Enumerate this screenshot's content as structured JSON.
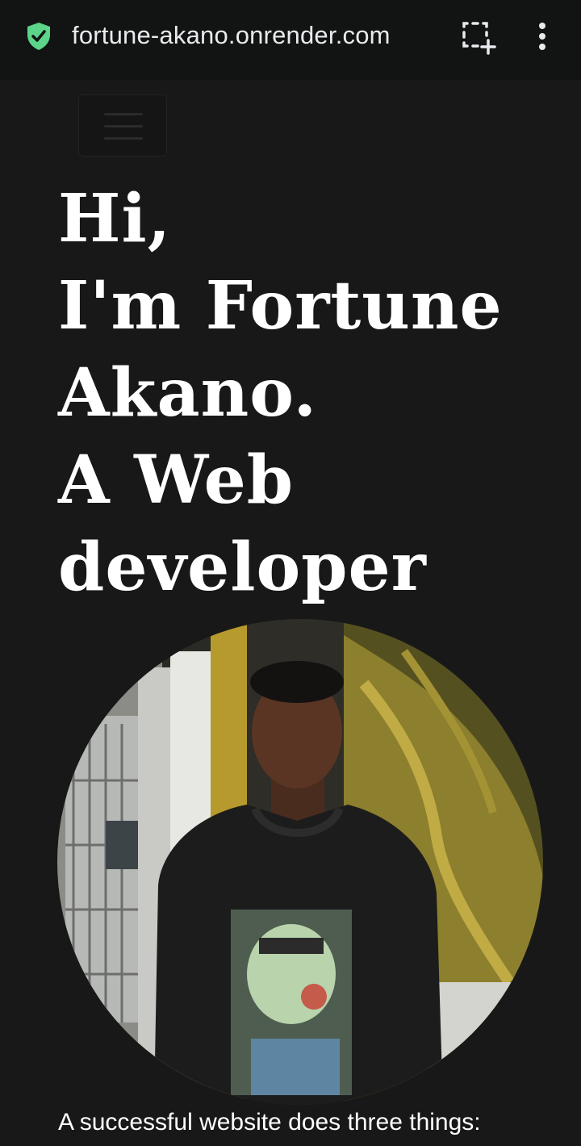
{
  "browser": {
    "url": "fortune-akano.onrender.com",
    "icons": [
      "shield-check-icon",
      "screenshot-select-icon",
      "more-vertical-icon"
    ],
    "accent_color": "#5cd48a"
  },
  "nav": {
    "menu_icon": "hamburger-menu-icon"
  },
  "hero": {
    "heading_lines": [
      "Hi,",
      "I'm Fortune",
      "Akano.",
      "A Web",
      "developer"
    ],
    "intro_text": "A successful website does three things:"
  },
  "colors": {
    "background": "#181818",
    "text": "#ffffff",
    "browser_bar": "#111412"
  }
}
